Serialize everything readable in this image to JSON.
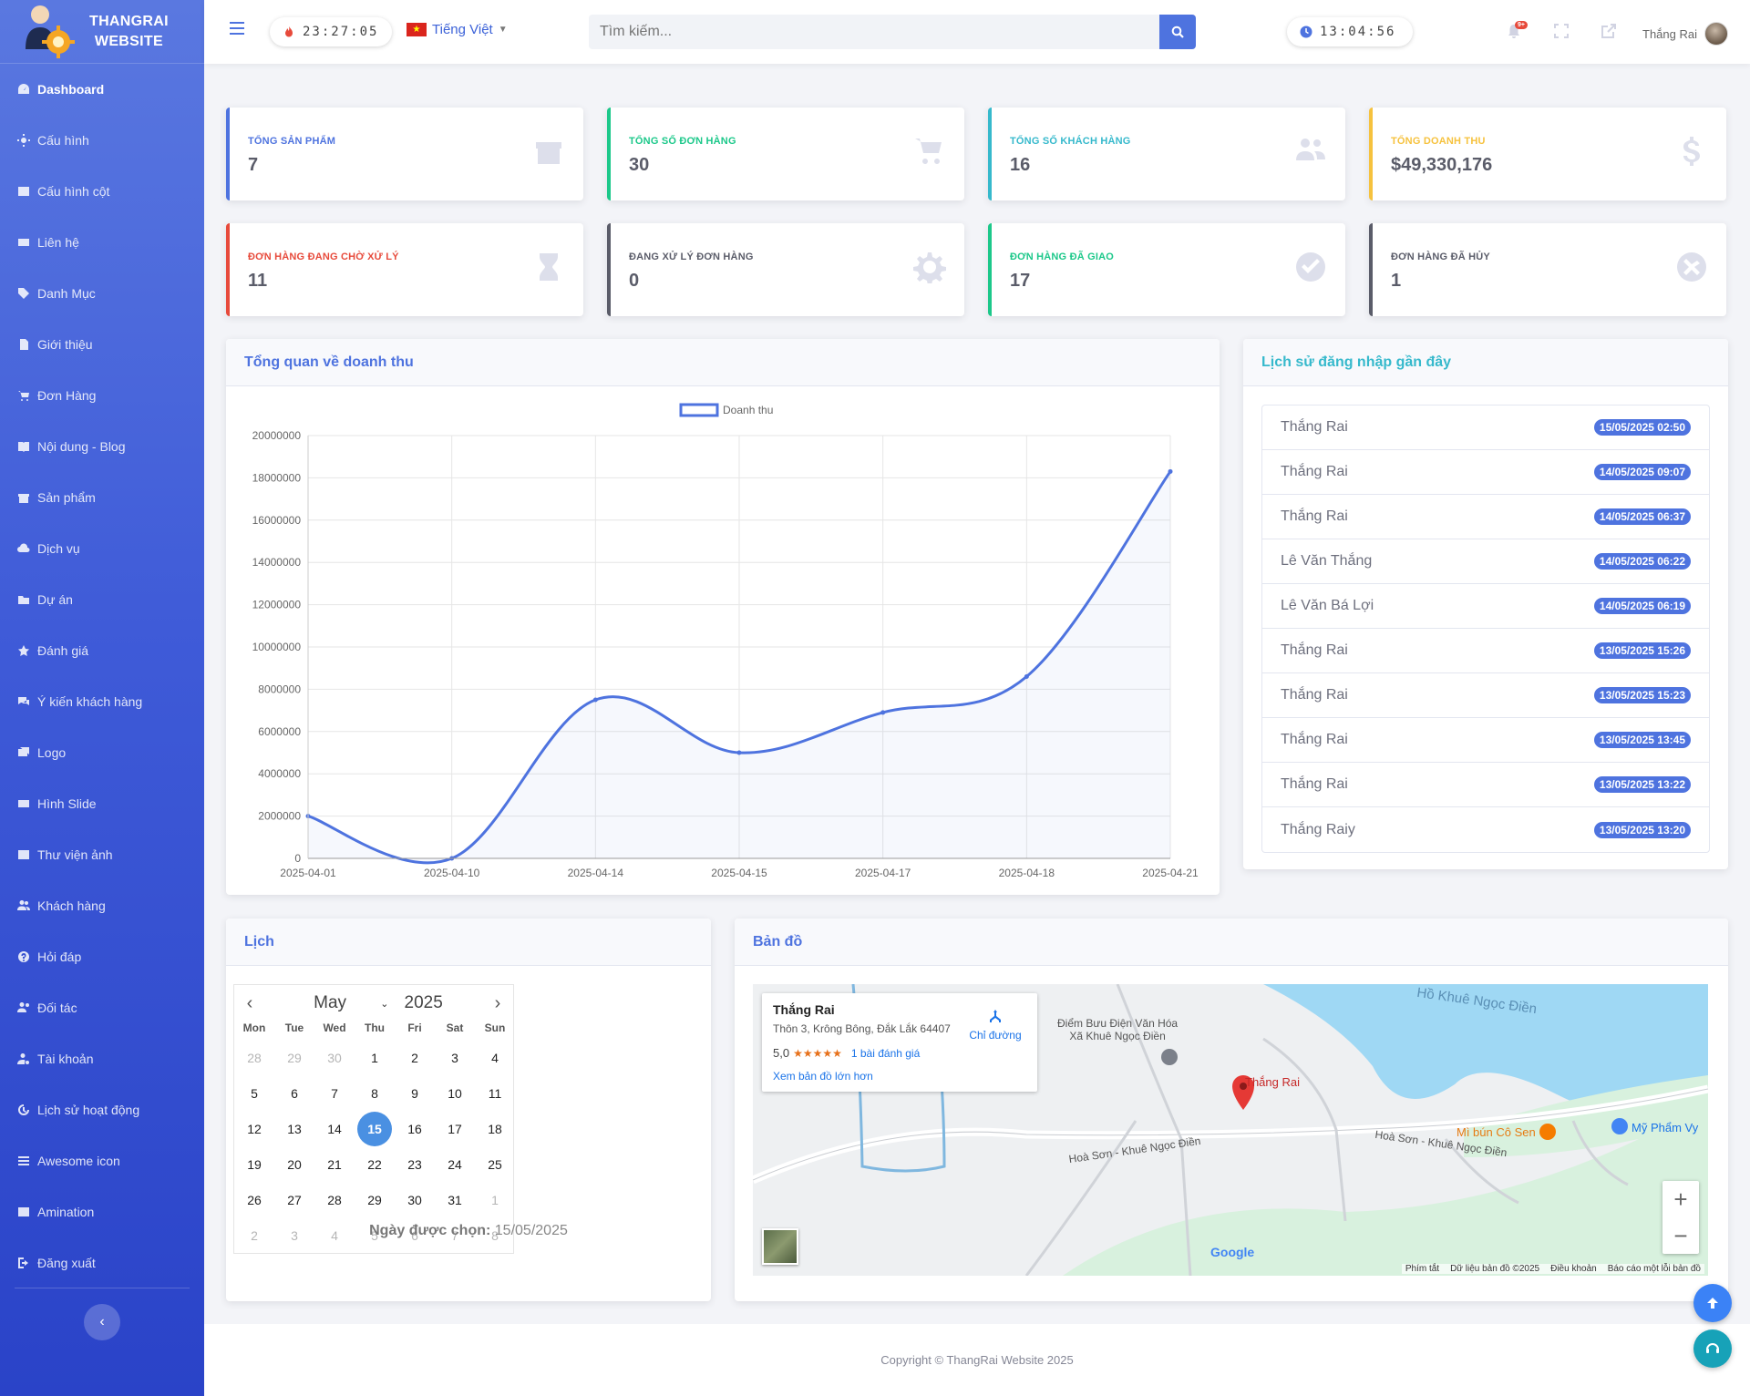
{
  "brand": {
    "line1": "THANGRAI",
    "line2": "WEBSITE"
  },
  "sidebar": {
    "items": [
      {
        "label": "Dashboard",
        "icon": "tachometer-icon"
      },
      {
        "label": "Cấu hình",
        "icon": "cogs-icon"
      },
      {
        "label": "Cấu hình cột",
        "icon": "table-icon"
      },
      {
        "label": "Liên hệ",
        "icon": "address-card-icon"
      },
      {
        "label": "Danh Mục",
        "icon": "tags-icon"
      },
      {
        "label": "Giới thiệu",
        "icon": "file-icon"
      },
      {
        "label": "Đơn Hàng",
        "icon": "cart-icon"
      },
      {
        "label": "Nội dung - Blog",
        "icon": "book-icon"
      },
      {
        "label": "Sản phẩm",
        "icon": "box-icon"
      },
      {
        "label": "Dịch vụ",
        "icon": "cloud-icon"
      },
      {
        "label": "Dự án",
        "icon": "folder-icon"
      },
      {
        "label": "Đánh giá",
        "icon": "star-icon"
      },
      {
        "label": "Ý kiến khách hàng",
        "icon": "comments-icon"
      },
      {
        "label": "Logo",
        "icon": "images-icon"
      },
      {
        "label": "Hình Slide",
        "icon": "slides-icon"
      },
      {
        "label": "Thư viện ảnh",
        "icon": "image-icon"
      },
      {
        "label": "Khách hàng",
        "icon": "users-icon"
      },
      {
        "label": "Hỏi đáp",
        "icon": "question-icon"
      },
      {
        "label": "Đối tác",
        "icon": "user-friends-icon"
      },
      {
        "label": "Tài khoản",
        "icon": "user-cog-icon"
      },
      {
        "label": "Lịch sử hoạt động",
        "icon": "history-icon"
      },
      {
        "label": "Awesome icon",
        "icon": "list-icon"
      },
      {
        "label": "Amination",
        "icon": "film-icon"
      },
      {
        "label": "Đăng xuất",
        "icon": "sign-out-icon"
      }
    ],
    "toggle_glyph": "‹"
  },
  "topbar": {
    "clock_left": "23:27:05",
    "language": "Tiếng Việt",
    "search_placeholder": "Tìm kiếm...",
    "clock_right": "13:04:56",
    "notification_badge": "9+",
    "username": "Thắng Rai"
  },
  "stats": [
    {
      "label": "TỔNG SẢN PHẨM",
      "value": "7",
      "color": "#4e73df",
      "icon": "box-icon"
    },
    {
      "label": "TỔNG SỐ ĐƠN HÀNG",
      "value": "30",
      "color": "#1cc88a",
      "icon": "cart-icon"
    },
    {
      "label": "TỔNG SỐ KHÁCH HÀNG",
      "value": "16",
      "color": "#36b9cc",
      "icon": "users-icon"
    },
    {
      "label": "TỔNG DOANH THU",
      "value": "$49,330,176",
      "color": "#f6c23e",
      "icon": "dollar-icon"
    },
    {
      "label": "ĐƠN HÀNG ĐANG CHỜ XỬ LÝ",
      "value": "11",
      "color": "#e74a3b",
      "icon": "hourglass-icon"
    },
    {
      "label": "ĐANG XỬ LÝ ĐƠN HÀNG",
      "value": "0",
      "color": "#5a5c69",
      "icon": "cog-icon"
    },
    {
      "label": "ĐƠN HÀNG ĐÃ GIAO",
      "value": "17",
      "color": "#1cc88a",
      "icon": "check-circle-icon"
    },
    {
      "label": "ĐƠN HÀNG ĐÃ HỦY",
      "value": "1",
      "color": "#5a5c69",
      "icon": "times-circle-icon"
    }
  ],
  "revenue": {
    "title": "Tổng quan về doanh thu"
  },
  "chart_data": {
    "type": "line",
    "x": [
      "2025-04-01",
      "2025-04-10",
      "2025-04-14",
      "2025-04-15",
      "2025-04-17",
      "2025-04-18",
      "2025-04-21"
    ],
    "series": [
      {
        "name": "Doanh thu",
        "values": [
          2000000,
          0,
          7500000,
          5000000,
          6900000,
          8600000,
          18300000
        ],
        "color": "#4e73df"
      }
    ],
    "ylim": [
      0,
      20000000
    ],
    "yticks": [
      0,
      2000000,
      4000000,
      6000000,
      8000000,
      10000000,
      12000000,
      14000000,
      16000000,
      18000000,
      20000000
    ],
    "grid": true,
    "legend": "top-center",
    "fill": true
  },
  "logins": {
    "title": "Lịch sử đăng nhập gần đây",
    "rows": [
      {
        "name": "Thắng Rai",
        "time": "15/05/2025 02:50"
      },
      {
        "name": "Thắng Rai",
        "time": "14/05/2025 09:07"
      },
      {
        "name": "Thắng Rai",
        "time": "14/05/2025 06:37"
      },
      {
        "name": "Lê Văn Thắng",
        "time": "14/05/2025 06:22"
      },
      {
        "name": "Lê Văn Bá Lợi",
        "time": "14/05/2025 06:19"
      },
      {
        "name": "Thắng Rai",
        "time": "13/05/2025 15:26"
      },
      {
        "name": "Thắng Rai",
        "time": "13/05/2025 15:23"
      },
      {
        "name": "Thắng Rai",
        "time": "13/05/2025 13:45"
      },
      {
        "name": "Thắng Rai",
        "time": "13/05/2025 13:22"
      },
      {
        "name": "Thắng Raiy",
        "time": "13/05/2025 13:20"
      }
    ]
  },
  "calendar": {
    "title": "Lịch",
    "month": "May",
    "year": "2025",
    "dow": [
      "Mon",
      "Tue",
      "Wed",
      "Thu",
      "Fri",
      "Sat",
      "Sun"
    ],
    "days": [
      [
        "28",
        "29",
        "30",
        "1",
        "2",
        "3",
        "4"
      ],
      [
        "5",
        "6",
        "7",
        "8",
        "9",
        "10",
        "11"
      ],
      [
        "12",
        "13",
        "14",
        "15",
        "16",
        "17",
        "18"
      ],
      [
        "19",
        "20",
        "21",
        "22",
        "23",
        "24",
        "25"
      ],
      [
        "26",
        "27",
        "28",
        "29",
        "30",
        "31",
        "1"
      ],
      [
        "2",
        "3",
        "4",
        "5",
        "6",
        "7",
        "8"
      ]
    ],
    "selected_day": "15",
    "picked_label": "Ngày được chọn:",
    "picked_value": "15/05/2025"
  },
  "map": {
    "title": "Bản đồ",
    "place": "Thắng Rai",
    "address": "Thôn 3, Krông Bông, Đắk Lắk 64407",
    "rating": "5,0",
    "stars": "★★★★★",
    "reviews": "1 bài đánh giá",
    "bigger": "Xem bản đồ lớn hơn",
    "directions": "Chỉ đường",
    "lake": "Hồ Khuê Ngọc Điền",
    "post_office_1": "Điểm Bưu Điện Văn Hóa",
    "post_office_2": "Xã Khuê Ngọc Điền",
    "pin_label": "Thắng Rai",
    "road_1": "Hoà Sơn - Khuê Ngọc Điền",
    "road_2": "Hoà Sơn - Khuê Ngọc Điền",
    "shop_1": "Mì bún Cô Sen",
    "shop_2": "Mỹ Phẩm Vy",
    "google": "Google",
    "footer": [
      "Phím tắt",
      "Dữ liệu bản đồ ©2025",
      "Điều khoản",
      "Báo cáo một lỗi bản đồ"
    ]
  },
  "footer": {
    "text": "Copyright © ThangRai Website 2025"
  }
}
